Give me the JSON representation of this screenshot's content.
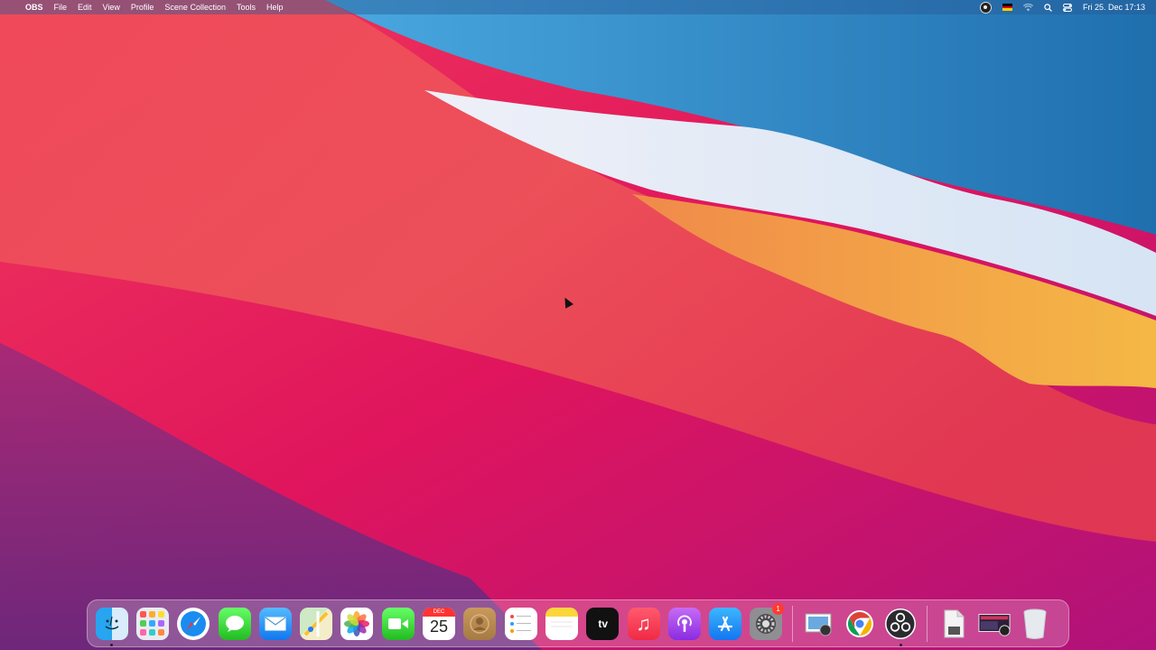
{
  "menubar": {
    "apple_symbol": "",
    "app_name": "OBS",
    "items": [
      "File",
      "Edit",
      "View",
      "Profile",
      "Scene Collection",
      "Tools",
      "Help"
    ],
    "clock": "Fri 25. Dec  17:13"
  },
  "dock": {
    "calendar": {
      "month": "DEC",
      "day": "25"
    },
    "system_preferences_badge": "1",
    "apple_tv_label": "tv"
  },
  "colors": {
    "menubar_bg": "#3c6ea0",
    "wallpaper_red": "#e8123e",
    "wallpaper_blue": "#2f8ccc",
    "wallpaper_orange": "#f4a23a"
  }
}
